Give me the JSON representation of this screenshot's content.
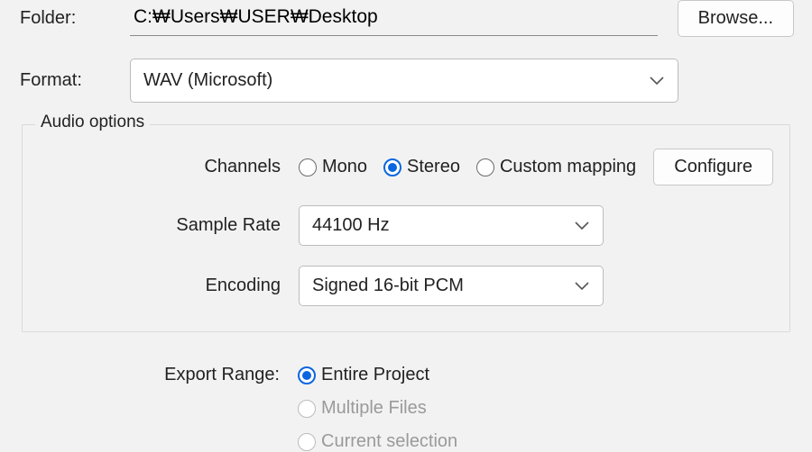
{
  "folder": {
    "label": "Folder:",
    "value": "C:₩Users₩USER₩Desktop",
    "browse": "Browse..."
  },
  "format": {
    "label": "Format:",
    "value": "WAV (Microsoft)"
  },
  "audio_options": {
    "legend": "Audio options",
    "channels": {
      "label": "Channels",
      "mono": "Mono",
      "stereo": "Stereo",
      "custom": "Custom mapping",
      "configure": "Configure"
    },
    "sample_rate": {
      "label": "Sample Rate",
      "value": "44100 Hz"
    },
    "encoding": {
      "label": "Encoding",
      "value": "Signed 16-bit PCM"
    }
  },
  "export_range": {
    "label": "Export Range:",
    "entire": "Entire Project",
    "multiple": "Multiple Files",
    "current": "Current selection"
  }
}
